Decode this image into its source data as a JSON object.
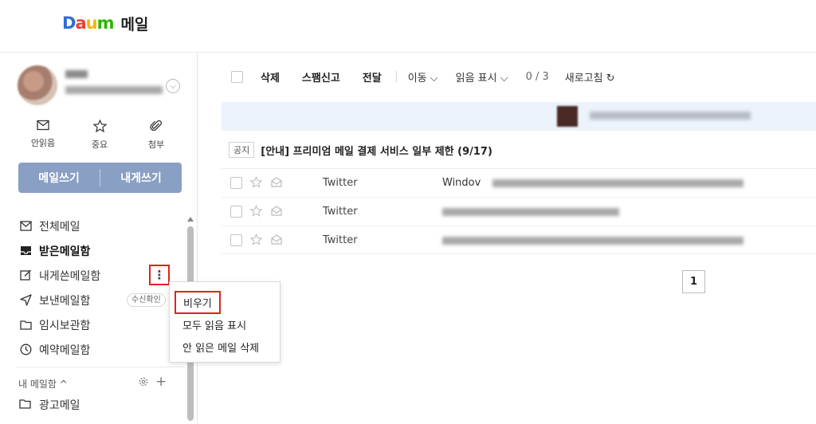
{
  "header": {
    "logo": {
      "d1": "D",
      "a": "a",
      "u": "u",
      "m": "m"
    },
    "service_name": "메일"
  },
  "quick_actions": [
    {
      "label": "안읽음",
      "icon": "envelope-icon"
    },
    {
      "label": "중요",
      "icon": "star-icon"
    },
    {
      "label": "첨부",
      "icon": "paperclip-icon"
    }
  ],
  "compose": {
    "write_label": "메일쓰기",
    "self_label": "내게쓰기"
  },
  "folders": [
    {
      "label": "전체메일",
      "icon": "mail-icon"
    },
    {
      "label": "받은메일함",
      "icon": "inbox-icon"
    },
    {
      "label": "내게쓴메일함",
      "icon": "edit-icon"
    },
    {
      "label": "보낸메일함",
      "icon": "send-icon"
    },
    {
      "label": "임시보관함",
      "icon": "folder-icon"
    },
    {
      "label": "예약메일함",
      "icon": "clock-icon"
    }
  ],
  "more_button_label": "⋮",
  "receipt_badge": "수신확인",
  "my_mailbox": {
    "label": "내 메일함 ^",
    "add": "+"
  },
  "custom_folder": "광고메일",
  "context_menu": [
    "비우기",
    "모두 읽음 표시",
    "안 읽은 메일 삭제"
  ],
  "toolbar": {
    "delete": "삭제",
    "spam": "스팸신고",
    "forward": "전달",
    "move": "이동 ⌵",
    "mark_read": "읽음 표시 ⌵",
    "count": "0 / 3",
    "refresh": "새로고침 ↻"
  },
  "notice": {
    "tag": "공지",
    "text": "[안내] 프리미엄 메일 결제 서비스 일부 제한 (9/17)"
  },
  "messages": [
    {
      "sender": "Twitter",
      "subject_visible": "Windov"
    },
    {
      "sender": "Twitter",
      "subject_visible": ""
    },
    {
      "sender": "Twitter",
      "subject_visible": ""
    }
  ],
  "pagination": {
    "current": "1"
  },
  "colors": {
    "accent": "#8a9fc4",
    "highlight_border": "#d9261c",
    "banner_bg": "#edf3fb"
  }
}
